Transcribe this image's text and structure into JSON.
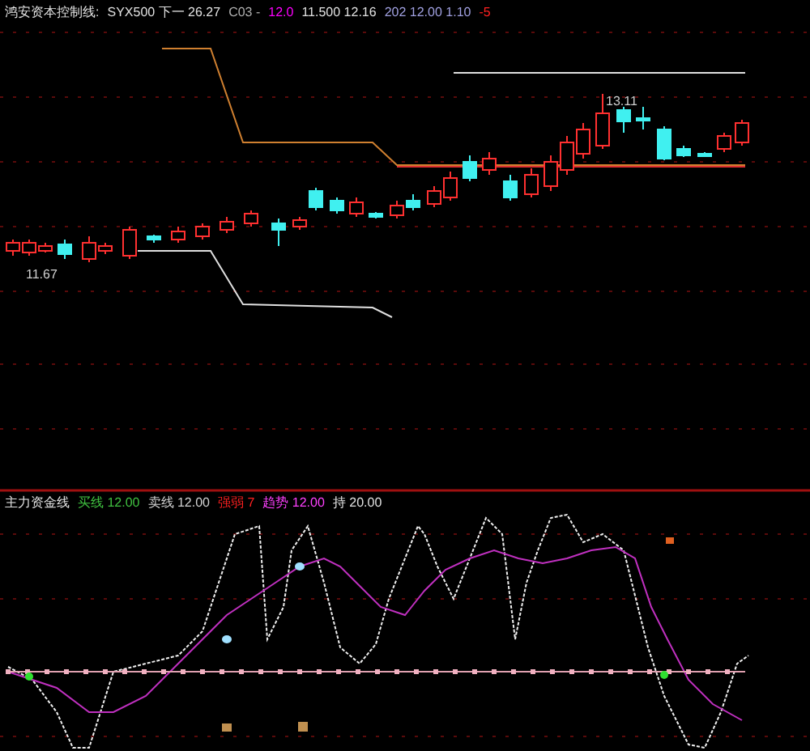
{
  "main_panel": {
    "legend": [
      {
        "text": "鸿安资本控制线:",
        "color": "#e0e0e0"
      },
      {
        "text": "SYX500 下一 26.27",
        "color": "#e0e0e0"
      },
      {
        "text": "C03 -",
        "color": "#b0b0b0"
      },
      {
        "text": "12.0",
        "color": "#ff00ff"
      },
      {
        "text": "11.500 12.16",
        "color": "#e0e0e0"
      },
      {
        "text": "202 12.00 1.10",
        "color": "#a0a0e0"
      },
      {
        "text": "-5",
        "color": "#ff2020"
      }
    ],
    "price_labels": [
      "13.11",
      "11.67"
    ]
  },
  "indicator_panel": {
    "legend": [
      {
        "text": "主力资金线",
        "color": "#e0e0e0"
      },
      {
        "text": "买线 12.00",
        "color": "#40c040"
      },
      {
        "text": "卖线 12.00",
        "color": "#d0d0d0"
      },
      {
        "text": "强弱 7",
        "color": "#ff2020"
      },
      {
        "text": "趋势 12.00",
        "color": "#ff40ff"
      },
      {
        "text": "持 20.00",
        "color": "#e0e0e0"
      }
    ]
  }
}
